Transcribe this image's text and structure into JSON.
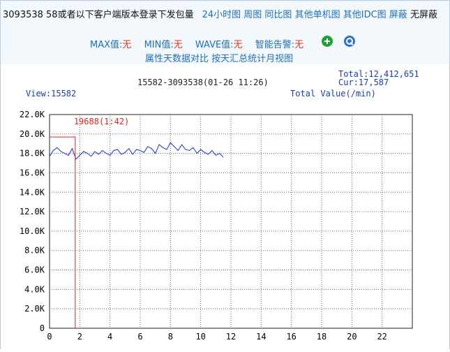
{
  "header": {
    "title_prefix": "3093538 58或者以下客户端版本登录下发包量",
    "links": [
      "24小时图",
      "周图",
      "同比图",
      "其他单机图",
      "其他IDC图",
      "屏蔽"
    ],
    "suffix_status": "无屏蔽",
    "metrics": [
      {
        "label": "MAX值:",
        "value": "无"
      },
      {
        "label": "MIN值:",
        "value": "无"
      },
      {
        "label": "WAVE值:",
        "value": "无"
      },
      {
        "label": "智能告警:",
        "value": "无"
      }
    ],
    "sub_links": [
      "属性天数据对比",
      "按天汇总统计月视图"
    ],
    "colors": {
      "link": "#1f6fb2",
      "value": "#e03a1e",
      "header_bg": "#f3f8fd"
    }
  },
  "chart_data": {
    "type": "line",
    "title": "15582-3093538(01-26 11:26)",
    "view_label": "View:15582",
    "total_label": "Total:12,412,651",
    "cur_label": "Cur:17,587",
    "ylabel": "Total Value(/min)",
    "xlim": [
      0,
      24
    ],
    "ylim": [
      0,
      22000
    ],
    "x_ticks": [
      "0",
      "2",
      "4",
      "6",
      "8",
      "10",
      "12",
      "14",
      "16",
      "18",
      "20",
      "22"
    ],
    "y_ticks": [
      "0",
      "2.0K",
      "4.0K",
      "6.0K",
      "8.0K",
      "10.0K",
      "12.0K",
      "14.0K",
      "16.0K",
      "18.0K",
      "20.0K",
      "22.0K"
    ],
    "peak_annotation": {
      "label": "19688(1:42)",
      "x": 1.7,
      "y": 19688
    },
    "series": [
      {
        "color": "#1d2fc8",
        "x": [
          0,
          0.25,
          0.5,
          0.75,
          1,
          1.25,
          1.5,
          1.75,
          2,
          2.25,
          2.5,
          2.75,
          3,
          3.25,
          3.5,
          3.75,
          4,
          4.25,
          4.5,
          4.75,
          5,
          5.25,
          5.5,
          5.75,
          6,
          6.25,
          6.5,
          6.75,
          7,
          7.25,
          7.5,
          7.75,
          8,
          8.25,
          8.5,
          8.75,
          9,
          9.25,
          9.5,
          9.75,
          10,
          10.25,
          10.5,
          10.75,
          11,
          11.25,
          11.5
        ],
        "y": [
          17700,
          18300,
          18600,
          18200,
          18000,
          17800,
          18500,
          17400,
          17800,
          18200,
          18000,
          17700,
          18200,
          17900,
          18300,
          18000,
          17800,
          18300,
          18400,
          17900,
          18100,
          18500,
          17900,
          18400,
          18300,
          18100,
          18700,
          18500,
          18000,
          18900,
          18600,
          18400,
          19100,
          18700,
          18300,
          18900,
          18400,
          18300,
          18600,
          18000,
          18400,
          18100,
          17900,
          18300,
          17800,
          18000,
          17600
        ]
      }
    ]
  }
}
